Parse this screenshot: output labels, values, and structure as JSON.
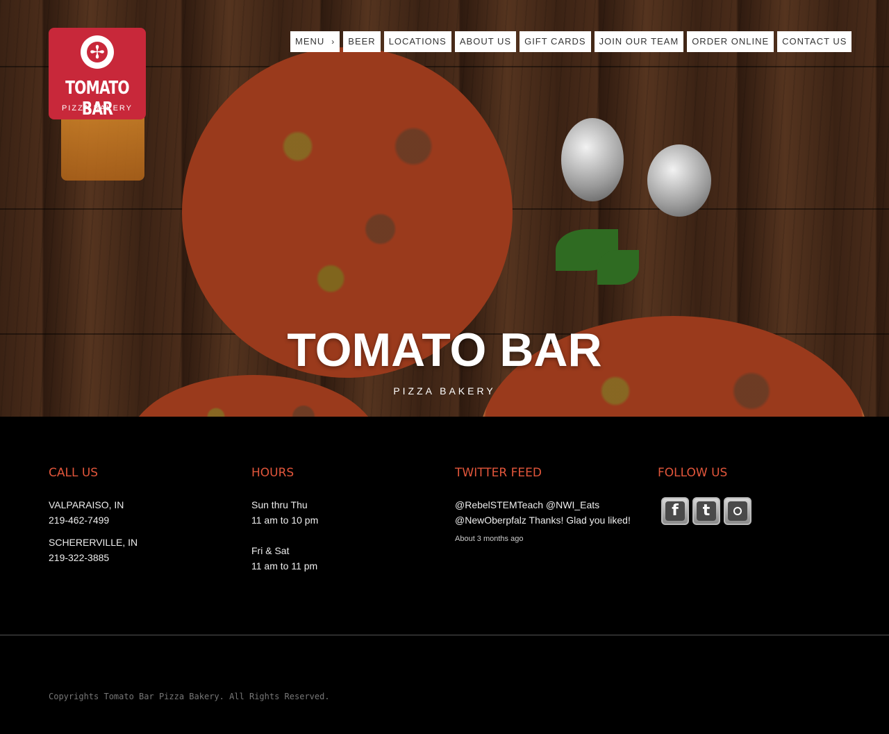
{
  "logo": {
    "title": "TOMATO BAR",
    "subtitle": "PIZZA BAKERY"
  },
  "nav": {
    "items": [
      {
        "label": "MENU",
        "has_submenu": true
      },
      {
        "label": "BEER"
      },
      {
        "label": "LOCATIONS"
      },
      {
        "label": "ABOUT US"
      },
      {
        "label": "GIFT CARDS"
      },
      {
        "label": "JOIN OUR TEAM"
      },
      {
        "label": "ORDER ONLINE"
      },
      {
        "label": "CONTACT US"
      }
    ]
  },
  "hero": {
    "title": "TOMATO BAR",
    "subtitle": "PIZZA BAKERY"
  },
  "call_us": {
    "heading": "CALL US",
    "locations": [
      {
        "city": "VALPARAISO, IN",
        "phone": "219-462-7499"
      },
      {
        "city": "SCHERERVILLE, IN",
        "phone": "219-322-3885"
      }
    ]
  },
  "hours": {
    "heading": "HOURS",
    "blocks": [
      {
        "days": "Sun thru Thu",
        "time": "11 am to 10 pm"
      },
      {
        "days": "Fri & Sat",
        "time": "11 am to 11 pm"
      }
    ]
  },
  "twitter": {
    "heading": "TWITTER FEED",
    "tweet": "@RebelSTEMTeach @NWI_Eats @NewOberpfalz Thanks! Glad you liked!",
    "time": "About 3 months ago"
  },
  "follow": {
    "heading": "FOLLOW US",
    "icons": [
      "facebook-icon",
      "twitter-icon",
      "instagram-icon"
    ]
  },
  "footer": {
    "copyright": "Copyrights Tomato Bar Pizza Bakery. All Rights Reserved."
  },
  "colors": {
    "accent": "#e2563b",
    "logo_bg": "#c8283a",
    "nav_bg": "#ffffff",
    "footer_bg": "#000000"
  }
}
